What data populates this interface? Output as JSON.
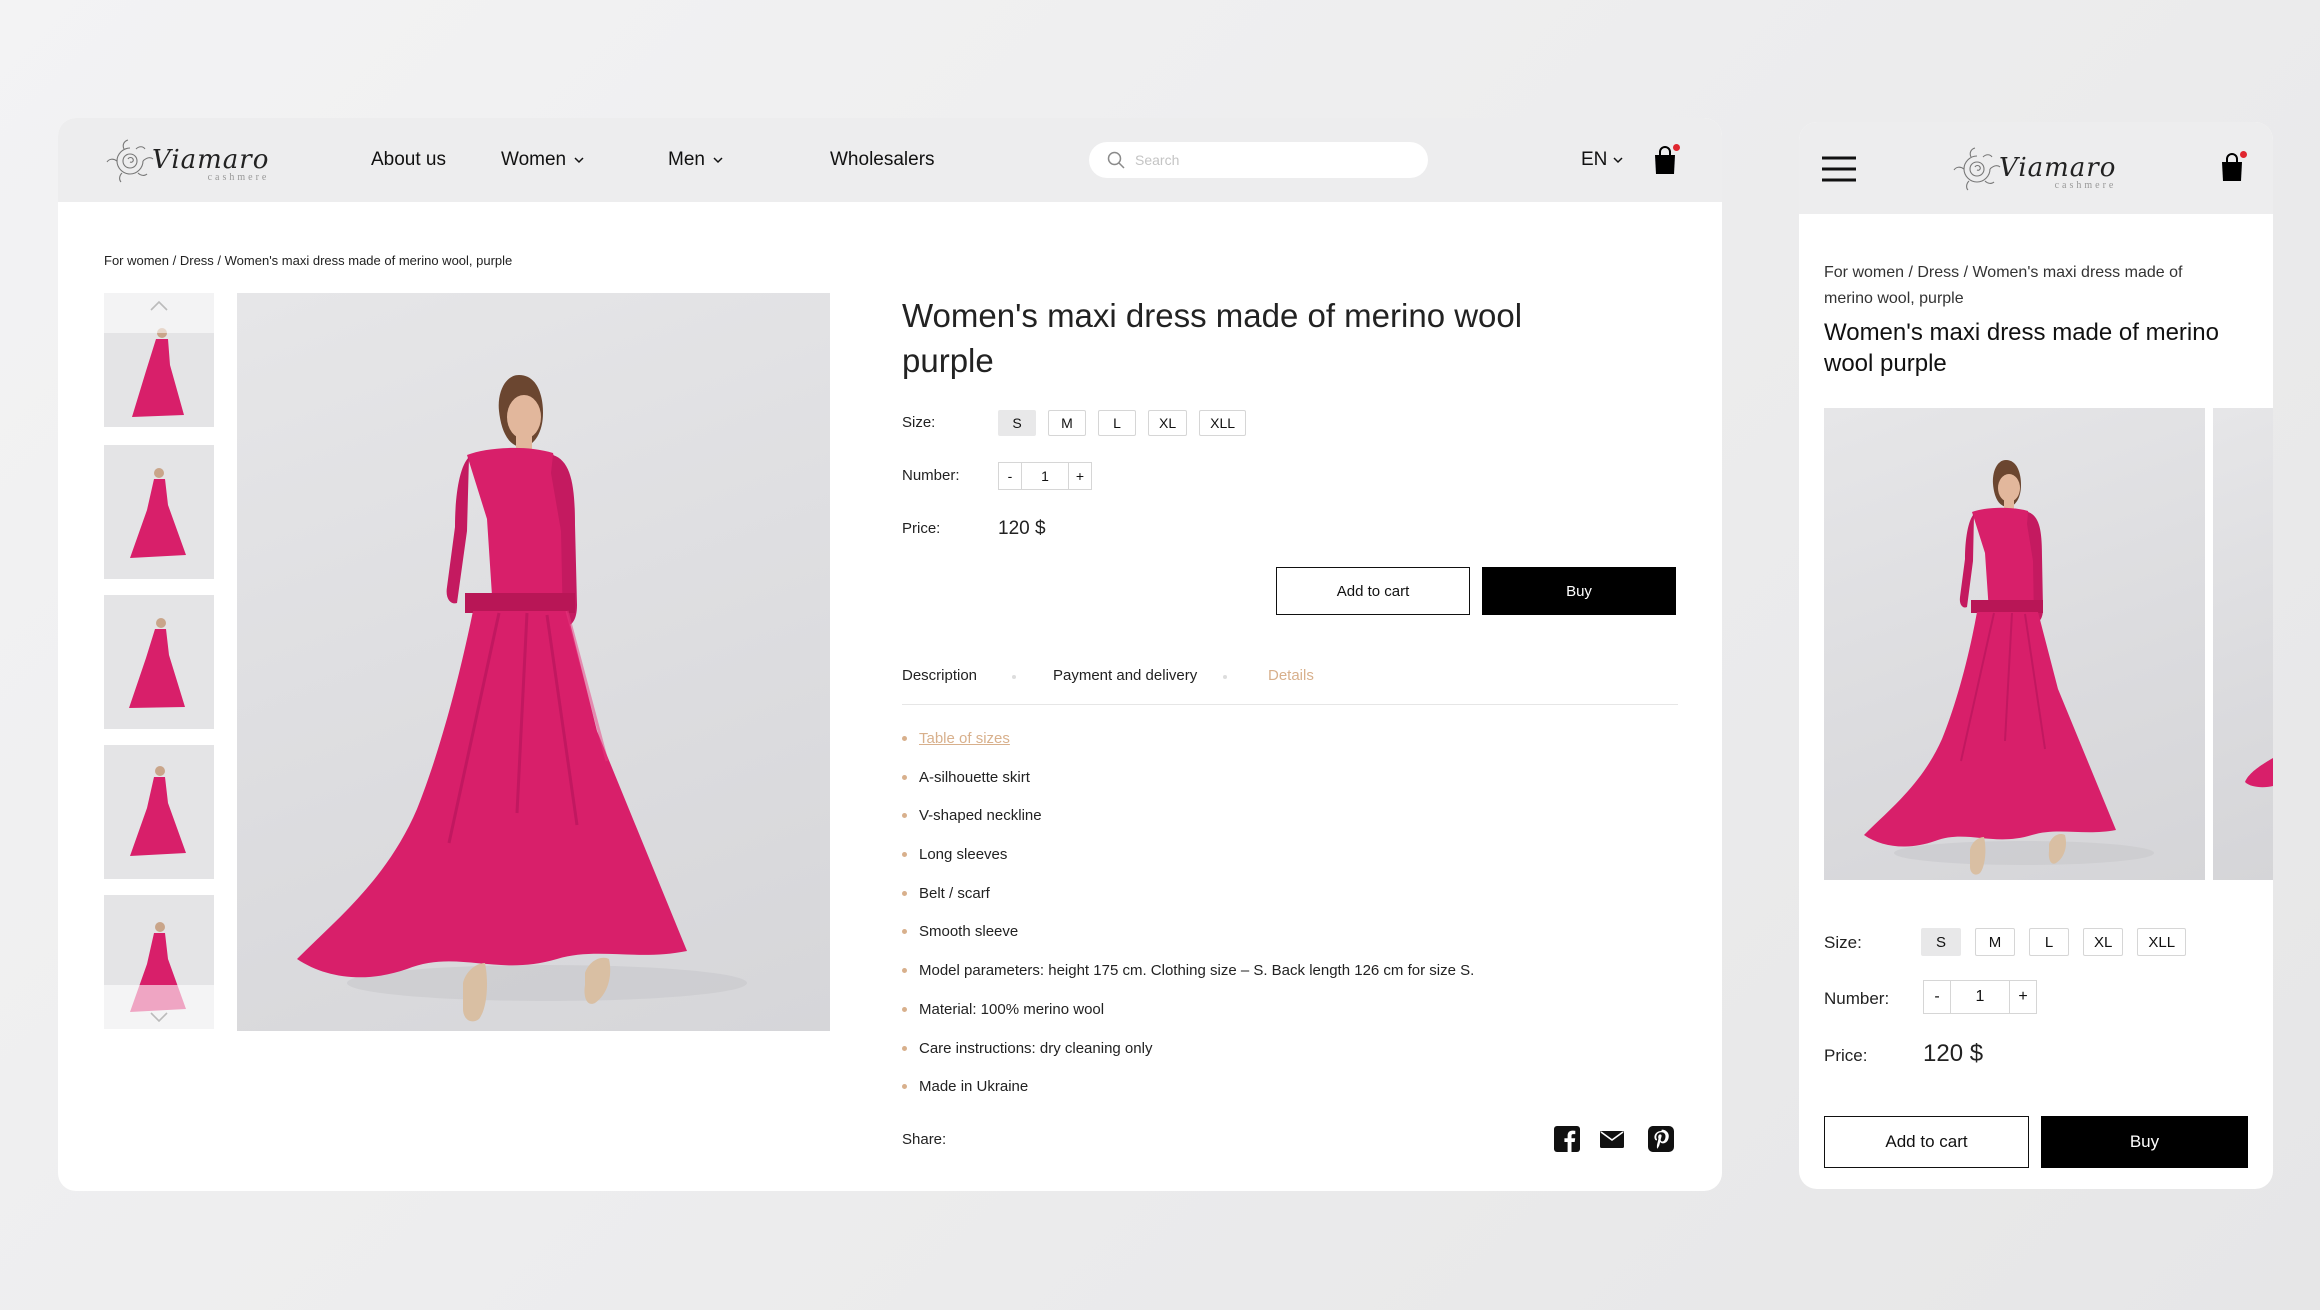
{
  "brand": {
    "name": "Viamaro",
    "sub": "cashmere"
  },
  "nav": {
    "items": [
      {
        "label": "About us",
        "dropdown": false
      },
      {
        "label": "Women",
        "dropdown": true
      },
      {
        "label": "Men",
        "dropdown": true
      },
      {
        "label": "Wholesalers",
        "dropdown": false
      }
    ],
    "search_placeholder": "Search",
    "language": "EN"
  },
  "breadcrumb": "For women / Dress / Women's maxi dress made of merino wool, purple",
  "product": {
    "title": "Women's maxi dress made of merino wool purple",
    "size_label": "Size:",
    "sizes": [
      "S",
      "M",
      "L",
      "XL",
      "XLL"
    ],
    "selected_size": "S",
    "number_label": "Number:",
    "minus": "-",
    "plus": "+",
    "quantity": "1",
    "price_label": "Price:",
    "price": "120 $",
    "add_to_cart": "Add to cart",
    "buy": "Buy"
  },
  "tabs": [
    {
      "label": "Description",
      "active": false
    },
    {
      "label": "Payment and delivery",
      "active": false
    },
    {
      "label": "Details",
      "active": true
    }
  ],
  "details": [
    "Table of sizes",
    "A-silhouette skirt",
    "V-shaped neckline",
    "Long sleeves",
    "Belt / scarf",
    "Smooth sleeve",
    "Model parameters: height 175 cm. Clothing size – S. Back length 126 cm for size S.",
    "Material: 100% merino wool",
    "Care instructions: dry cleaning only",
    "Made in Ukraine"
  ],
  "share": {
    "label": "Share:",
    "icons": [
      "facebook-icon",
      "email-icon",
      "pinterest-icon"
    ]
  },
  "colors": {
    "accent": "#d8b08c",
    "dress": "#d81f6a",
    "header_bg": "#ededee",
    "cart_badge": "#e0262f"
  }
}
